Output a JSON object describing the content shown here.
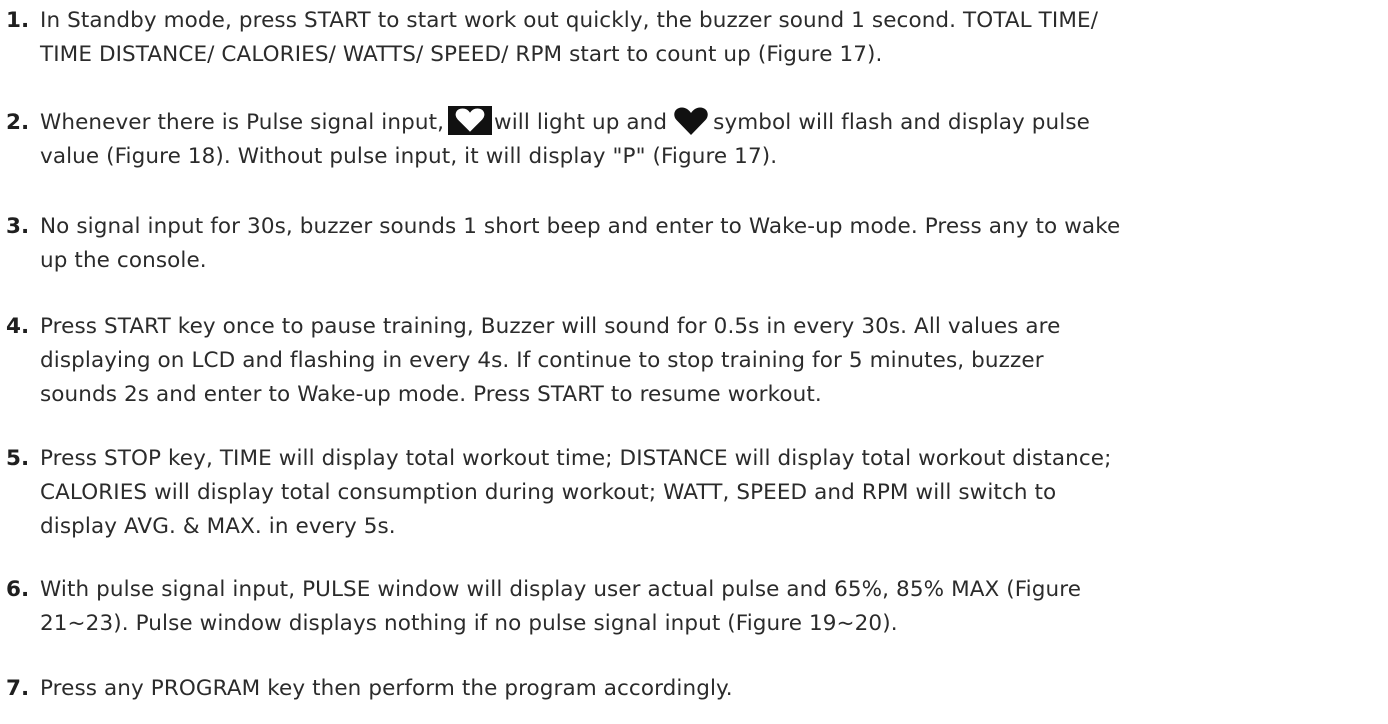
{
  "items": [
    {
      "number": "1.",
      "lines": [
        "In Standby mode, press START to start work out quickly, the buzzer sound 1 second. TOTAL TIME/",
        "TIME DISTANCE/ CALORIES/ WATTS/ SPEED/ RPM start to count up (Figure 17)."
      ]
    },
    {
      "number": "2.",
      "line1_a": "Whenever there is Pulse signal input,",
      "line1_b": "will light up and",
      "line1_c": "symbol will flash and display pulse",
      "line2": "value (Figure 18). Without pulse input, it will display \"P\" (Figure 17).",
      "icons": [
        "heart-outline-box-icon",
        "heart-solid-icon"
      ]
    },
    {
      "number": "3.",
      "lines": [
        "No signal input for 30s, buzzer sounds 1 short beep and enter to Wake-up mode. Press any to wake",
        "up the console."
      ]
    },
    {
      "number": "4.",
      "lines": [
        "Press START key once to pause training, Buzzer will sound for 0.5s in every 30s. All values are",
        "displaying on LCD and flashing in every 4s. If continue to stop training for 5 minutes, buzzer",
        "sounds 2s and enter to Wake-up mode. Press START to resume workout."
      ]
    },
    {
      "number": "5.",
      "lines": [
        "Press STOP key, TIME will display total workout time; DISTANCE will display total workout distance;",
        "CALORIES will display total consumption during workout; WATT, SPEED and RPM will switch to",
        "display AVG. & MAX. in every 5s."
      ]
    },
    {
      "number": "6.",
      "lines": [
        "With pulse signal input, PULSE window will display user actual pulse and 65%, 85% MAX (Figure",
        "21~23). Pulse window displays nothing if no pulse signal input (Figure 19~20)."
      ]
    },
    {
      "number": "7.",
      "lines": [
        "Press any PROGRAM key then perform the program accordingly."
      ]
    }
  ],
  "colors": {
    "text": "#2b2b2b",
    "icon_bg": "#111111"
  }
}
